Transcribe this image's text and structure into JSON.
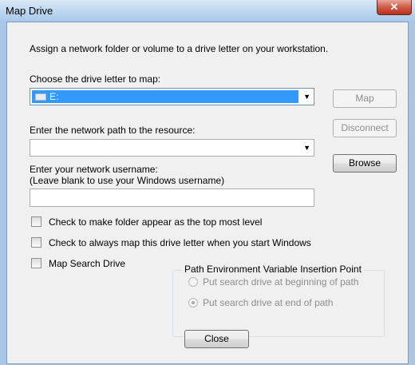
{
  "window": {
    "title": "Map Drive",
    "close_glyph": "✕"
  },
  "intro_text": "Assign a network folder or volume to a drive letter on your workstation.",
  "drive": {
    "label": "Choose the drive letter to map:",
    "selected_value": "E:",
    "icon": "drive-icon"
  },
  "path": {
    "label": "Enter the network path to the resource:",
    "value": ""
  },
  "username": {
    "label_line1": "Enter your network username:",
    "label_line2": "(Leave blank to use your Windows username)",
    "value": ""
  },
  "buttons": {
    "map": "Map",
    "disconnect": "Disconnect",
    "browse": "Browse",
    "close": "Close"
  },
  "options": {
    "top_level": {
      "label": "Check to make folder appear as the top most level",
      "checked": false
    },
    "always_map": {
      "label": "Check to always map this drive letter when you start Windows",
      "checked": false
    },
    "search_drive": {
      "label": "Map Search Drive",
      "checked": false
    }
  },
  "path_env": {
    "title": "Path Environment Variable Insertion Point",
    "beginning": {
      "label": "Put search drive at beginning of path",
      "selected": false
    },
    "end": {
      "label": "Put search drive at end of path",
      "selected": true
    }
  },
  "colors": {
    "selection": "#3399ff",
    "title_gradient": "#bcd6f0",
    "close_red": "#cf5b45"
  }
}
